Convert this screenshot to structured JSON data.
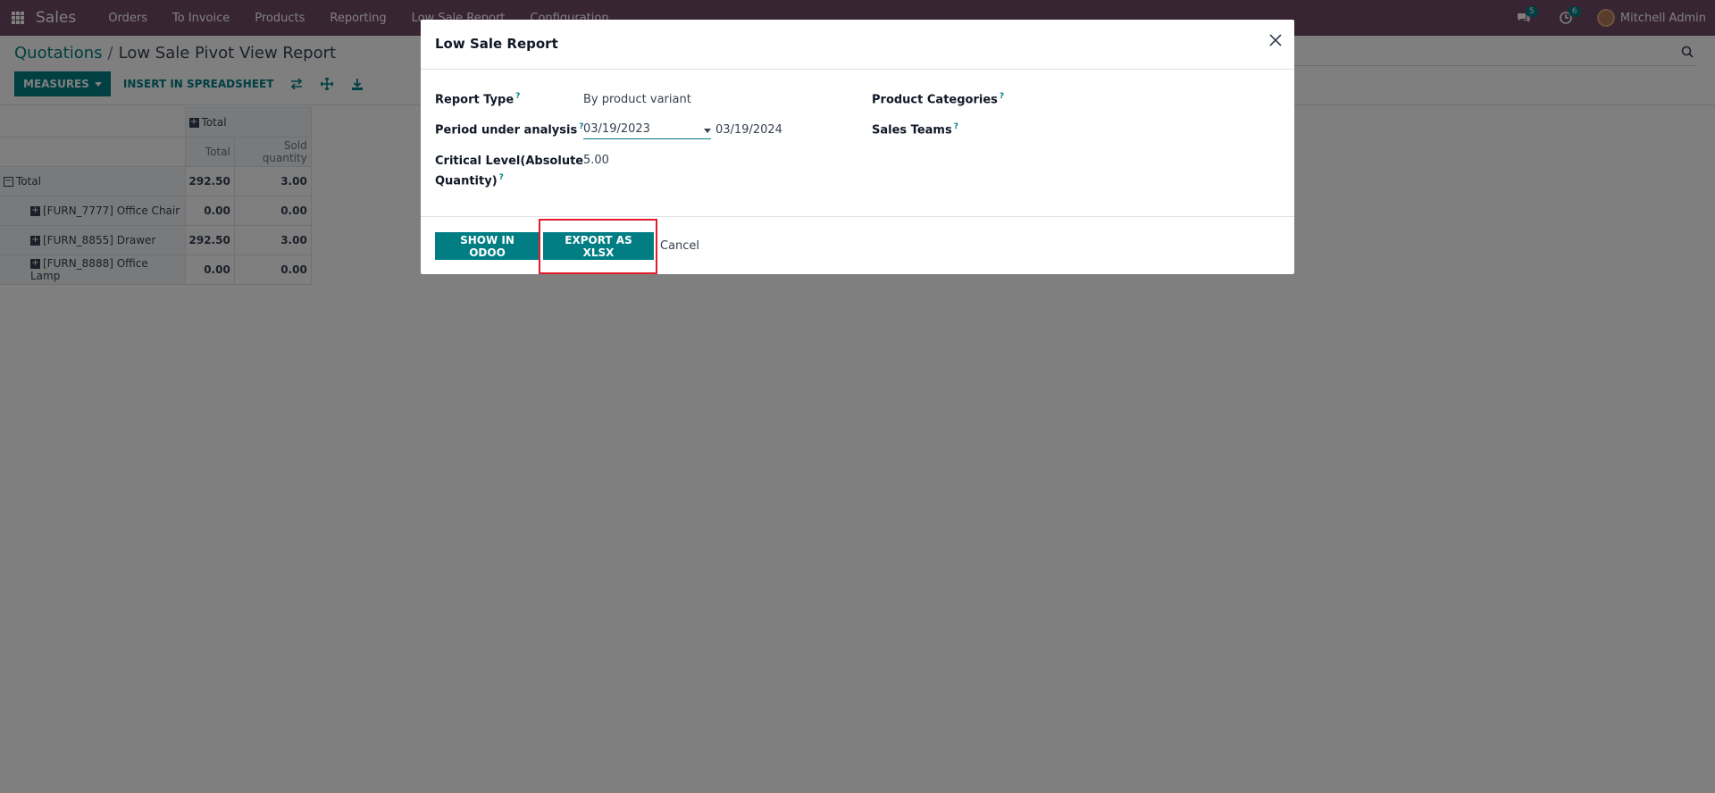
{
  "navbar": {
    "brand": "Sales",
    "menu": [
      "Orders",
      "To Invoice",
      "Products",
      "Reporting",
      "Low Sale Report",
      "Configuration"
    ],
    "messages_count": "5",
    "activities_count": "6",
    "user_name": "Mitchell Admin",
    "bg_color": "#714b67"
  },
  "control": {
    "breadcrumb_parent": "Quotations",
    "breadcrumb_sep": "/",
    "breadcrumb_current": "Low Sale Pivot View Report",
    "measures_label": "MEASURES",
    "insert_label": "INSERT IN SPREADSHEET",
    "icons": [
      "flip-axis-icon",
      "expand-all-icon",
      "download-icon"
    ]
  },
  "pivot": {
    "col_group_header": "Total",
    "measure_headers": [
      "Total",
      "Sold quantity"
    ],
    "total_row": {
      "label": "Total",
      "total": "292.50",
      "qty": "3.00"
    },
    "rows": [
      {
        "label": "[FURN_7777] Office Chair",
        "total": "0.00",
        "qty": "0.00"
      },
      {
        "label": "[FURN_8855] Drawer",
        "total": "292.50",
        "qty": "3.00"
      },
      {
        "label": "[FURN_8888] Office Lamp",
        "total": "0.00",
        "qty": "0.00"
      }
    ]
  },
  "modal": {
    "title": "Low Sale Report",
    "report_type_label": "Report Type",
    "report_type_value": "By product variant",
    "period_label": "Period under analysis",
    "period_start": "03/19/2023",
    "period_end": "03/19/2024",
    "critical_label_1": "Critical Level(Absolute",
    "critical_label_2": "Quantity)",
    "critical_value": "5.00",
    "categories_label": "Product Categories",
    "teams_label": "Sales Teams",
    "help_mark": "?",
    "show_button": "SHOW IN ODOO",
    "export_button": "EXPORT AS XLSX",
    "cancel_button": "Cancel"
  },
  "colors": {
    "primary": "#017e84",
    "highlight": "#e11d2a"
  }
}
